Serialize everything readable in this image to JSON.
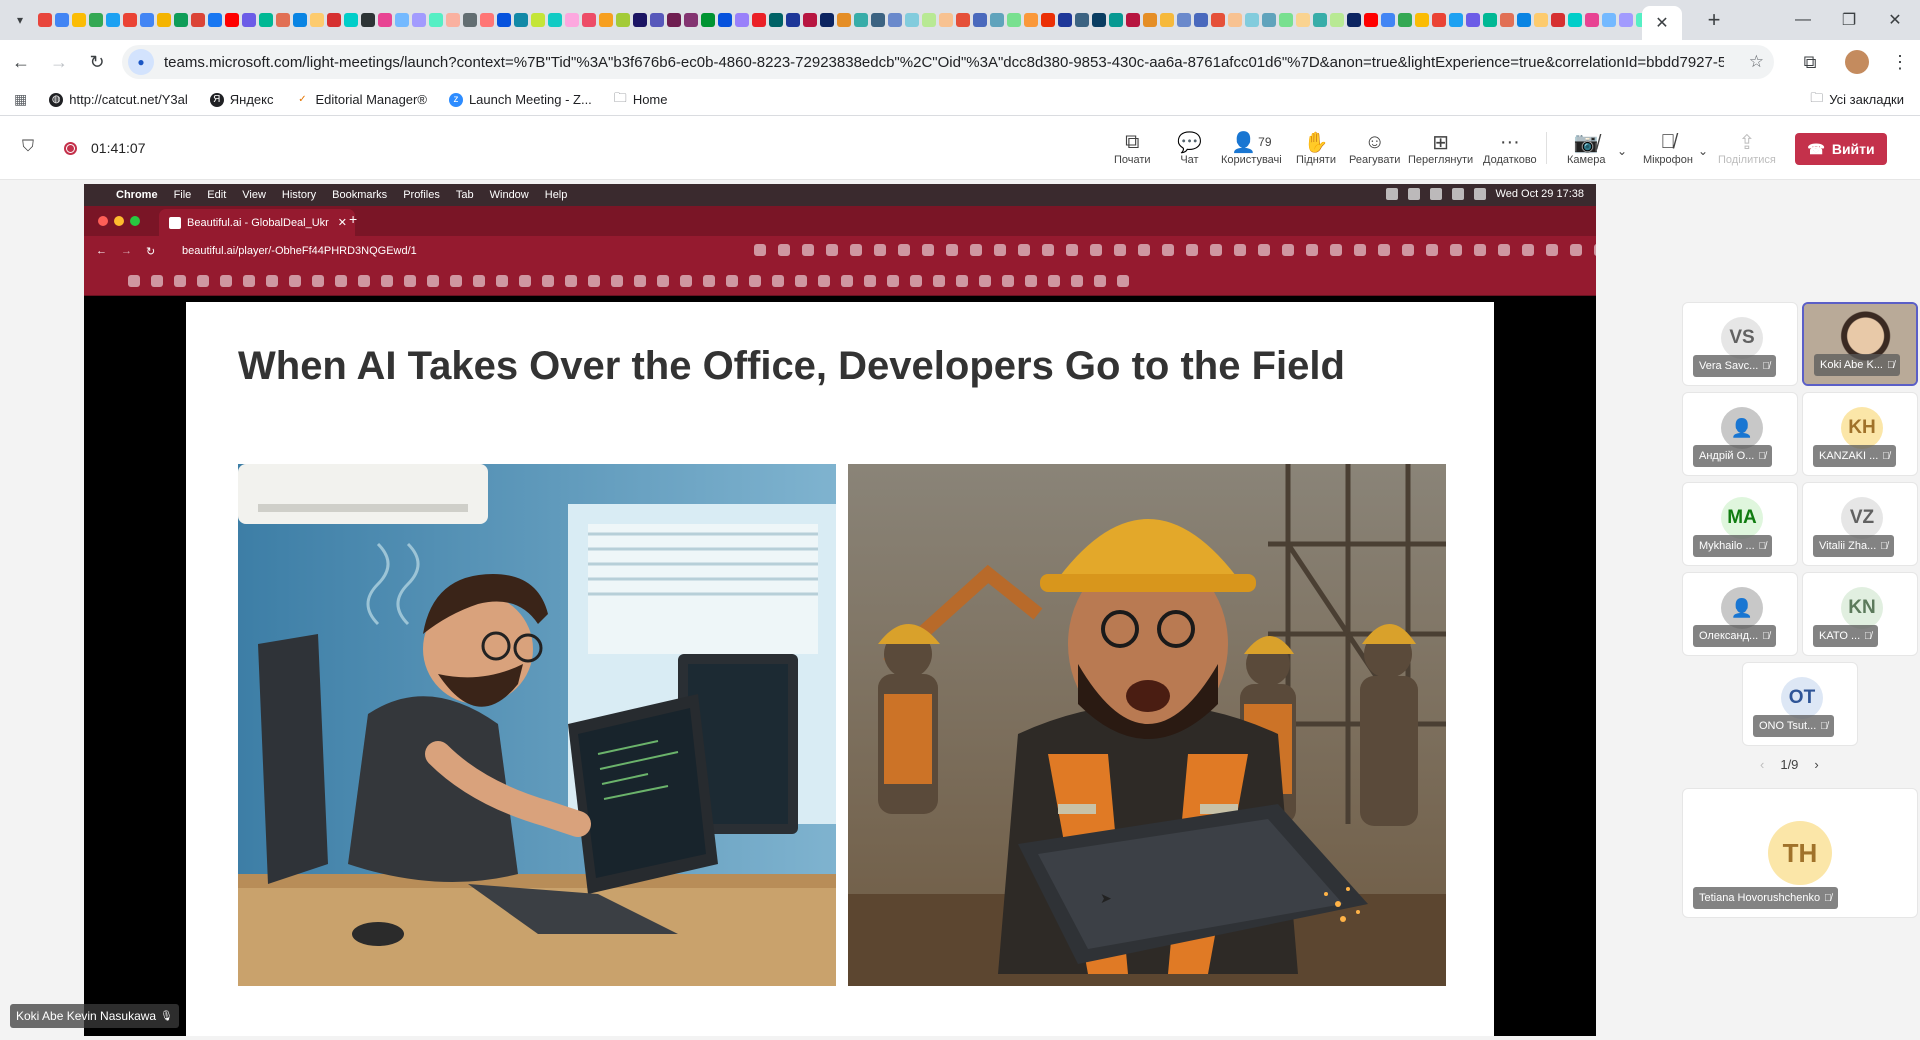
{
  "browser": {
    "tab_favicon_colors": [
      "#e8453c",
      "#4285f4",
      "#fbbc05",
      "#34a853",
      "#1da1f2",
      "#ea4335",
      "#4285f4",
      "#f4b400",
      "#0f9d58",
      "#db4437",
      "#1877f2",
      "#ff0000",
      "#6c5ce7",
      "#00b894",
      "#e17055",
      "#0984e3",
      "#fdcb6e",
      "#d63031",
      "#00cec9",
      "#2d3436",
      "#e84393",
      "#74b9ff",
      "#a29bfe",
      "#55efc4",
      "#fab1a0",
      "#636e72",
      "#ff7675",
      "#0652dd",
      "#1289a7",
      "#c4e538",
      "#12cbc4",
      "#fda7df",
      "#ed4c67",
      "#f79f1f",
      "#a3cb38",
      "#1b1464",
      "#5758bb",
      "#6f1e51",
      "#833471",
      "#009432",
      "#0652dd",
      "#9980fa",
      "#ea2027",
      "#006266",
      "#1e3799",
      "#b71540",
      "#0c2461",
      "#e58e26",
      "#38ada9",
      "#3c6382",
      "#6a89cc",
      "#82ccdd",
      "#b8e994",
      "#f8c291",
      "#e55039",
      "#4a69bd",
      "#60a3bc",
      "#78e08f",
      "#fa983a",
      "#eb2f06",
      "#1e3799",
      "#3c6382",
      "#0a3d62",
      "#079992",
      "#b71540",
      "#e58e26",
      "#f6b93b",
      "#6a89cc",
      "#4a69bd",
      "#e55039",
      "#f8c291",
      "#82ccdd",
      "#60a3bc",
      "#78e08f",
      "#fad390",
      "#38ada9",
      "#b8e994",
      "#0c2461",
      "#ff0000",
      "#4285f4",
      "#34a853",
      "#fbbc05",
      "#ea4335",
      "#1da1f2",
      "#6c5ce7",
      "#00b894",
      "#e17055",
      "#0984e3",
      "#fdcb6e",
      "#d63031",
      "#00cec9",
      "#e84393",
      "#74b9ff",
      "#a29bfe",
      "#55efc4"
    ],
    "url": "teams.microsoft.com/light-meetings/launch?context=%7B\"Tid\"%3A\"b3f676b6-ec0b-4860-8223-72923838edcb\"%2C\"Oid\"%3A\"dcc8d380-9853-430c-aa6a-8761afcc01d6\"%7D&anon=true&lightExperience=true&correlationId=bbdd7927-5f89-4708-9f55-e...",
    "bookmarks": [
      {
        "label": "http://catcut.net/Y3al",
        "icon": "globe-icon",
        "color": "#202124"
      },
      {
        "label": "Яндекс",
        "icon": "yandex-icon",
        "color": "#202124"
      },
      {
        "label": "Editorial Manager®",
        "icon": "em-icon",
        "color": "#e37400"
      },
      {
        "label": "Launch Meeting - Z...",
        "icon": "zoom-icon",
        "color": "#2d8cff"
      },
      {
        "label": "Home",
        "icon": "folder-icon",
        "color": "#5f6368"
      }
    ],
    "all_bookmarks": "Усі закладки"
  },
  "teams": {
    "timer": "01:41:07",
    "toolbar": [
      {
        "id": "start",
        "label": "Почати",
        "icon": "⧉"
      },
      {
        "id": "chat",
        "label": "Чат",
        "icon": "💬"
      },
      {
        "id": "people",
        "label": "Користувачі",
        "icon": "👤",
        "count": "79"
      },
      {
        "id": "raise",
        "label": "Підняти",
        "icon": "✋"
      },
      {
        "id": "react",
        "label": "Реагувати",
        "icon": "☺"
      },
      {
        "id": "view",
        "label": "Переглянути",
        "icon": "⊞"
      },
      {
        "id": "more",
        "label": "Додатково",
        "icon": "···"
      }
    ],
    "camera_label": "Камера",
    "mic_label": "Мікрофон",
    "share_label": "Поділитися",
    "leave_label": "Вийти",
    "leave_color": "#c4314b"
  },
  "shared": {
    "mac_menu": [
      "Chrome",
      "File",
      "Edit",
      "View",
      "History",
      "Bookmarks",
      "Profiles",
      "Tab",
      "Window",
      "Help"
    ],
    "mac_clock": "Wed Oct 29  17:38",
    "inner_tab_title": "Beautiful.ai - GlobalDeal_Ukr",
    "inner_url": "beautiful.ai/player/-ObheFf44PHRD3NQGEwd/1",
    "slide_title": "When AI Takes Over the Office, Developers Go to the Field",
    "presenter": "Koki Abe Kevin Nasukawa"
  },
  "participants": [
    {
      "initials": "VS",
      "name": "Vera Savc...",
      "bg": "#e6e6e6",
      "fg": "#616161"
    },
    {
      "initials": "",
      "name": "Koki Abe K...",
      "bg": "#c9b8a5",
      "fg": "#ffffff",
      "photo": true
    },
    {
      "initials": "",
      "name": "Андрій О...",
      "bg": "#e0e0e0",
      "fg": "#ffffff",
      "generic": true
    },
    {
      "initials": "KH",
      "name": "KANZAKI ...",
      "bg": "#fbe6a8",
      "fg": "#a0722a"
    },
    {
      "initials": "MA",
      "name": "Mykhailo ...",
      "bg": "#dff6dd",
      "fg": "#107c10"
    },
    {
      "initials": "VZ",
      "name": "Vitalii Zha...",
      "bg": "#e6e6e6",
      "fg": "#616161"
    },
    {
      "initials": "",
      "name": "Олександ...",
      "bg": "#e0e0e0",
      "fg": "#ffffff",
      "generic": true
    },
    {
      "initials": "KN",
      "name": "KATO ...",
      "bg": "#e1efe0",
      "fg": "#5c7a5b"
    },
    {
      "initials": "OT",
      "name": "ONO Tsut...",
      "bg": "#dde7f5",
      "fg": "#2f5597"
    }
  ],
  "pager": "1/9",
  "pinned": {
    "initials": "TH",
    "name": "Tetiana Hovorushchenko"
  }
}
